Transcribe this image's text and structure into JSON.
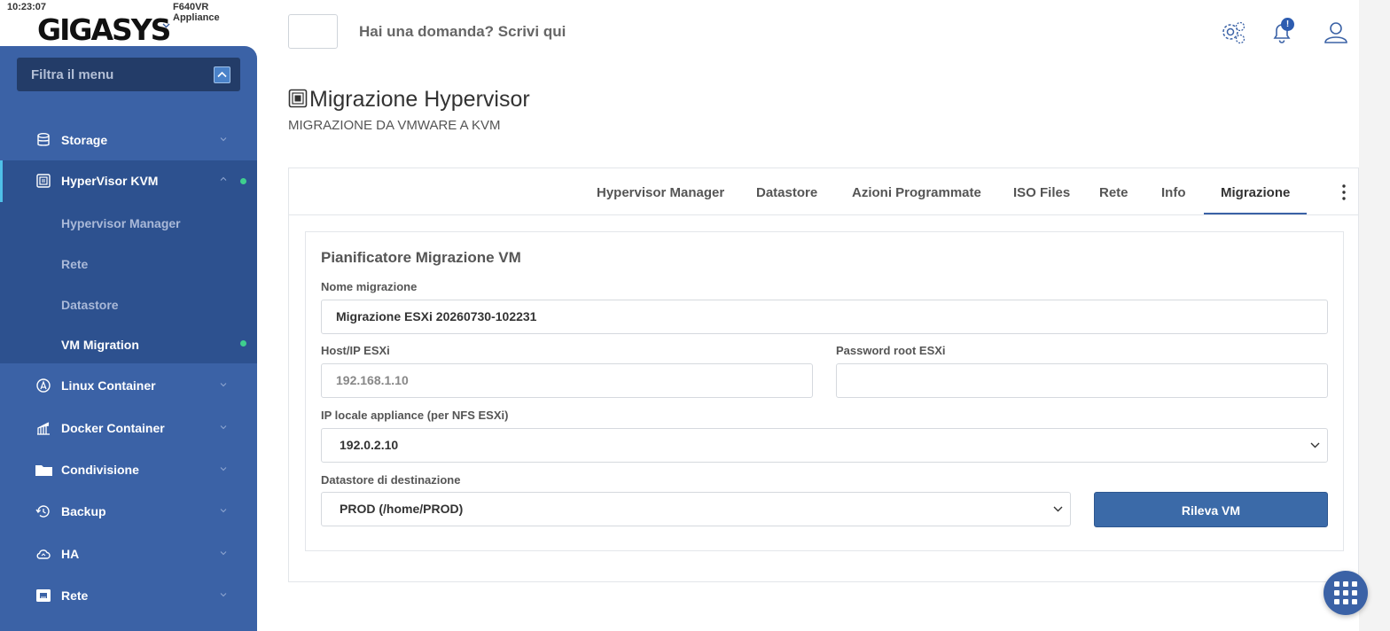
{
  "status": {
    "clock": "10:23:07",
    "appliance": "F640VR Appliance"
  },
  "brand": {
    "name": "GIGASYS"
  },
  "sidebar": {
    "filter_placeholder": "Filtra il menu",
    "items": [
      {
        "label": "Storage",
        "icon": "database-icon"
      },
      {
        "label": "HyperVisor KVM",
        "icon": "hypervisor-icon",
        "active": true
      },
      {
        "label": "Linux Container",
        "icon": "linux-icon"
      },
      {
        "label": "Docker Container",
        "icon": "docker-icon"
      },
      {
        "label": "Condivisione",
        "icon": "folder-icon"
      },
      {
        "label": "Backup",
        "icon": "backup-icon"
      },
      {
        "label": "HA",
        "icon": "cloud-icon"
      },
      {
        "label": "Rete",
        "icon": "network-icon"
      }
    ],
    "submenu": [
      {
        "label": "Hypervisor Manager"
      },
      {
        "label": "Rete"
      },
      {
        "label": "Datastore"
      },
      {
        "label": "VM Migration",
        "current": true
      }
    ]
  },
  "header": {
    "search_prompt": "Hai una domanda? Scrivi qui",
    "notification_badge": "!"
  },
  "page": {
    "title": "Migrazione Hypervisor",
    "subtitle": "MIGRAZIONE DA VMWARE A KVM"
  },
  "tabs": [
    {
      "label": "Hypervisor Manager"
    },
    {
      "label": "Datastore"
    },
    {
      "label": "Azioni Programmate"
    },
    {
      "label": "ISO Files"
    },
    {
      "label": "Rete"
    },
    {
      "label": "Info"
    },
    {
      "label": "Migrazione",
      "selected": true
    }
  ],
  "form": {
    "title": "Pianificatore Migrazione VM",
    "name_label": "Nome migrazione",
    "name_value": "Migrazione ESXi 20260730-102231",
    "host_label": "Host/IP ESXi",
    "host_placeholder": "192.168.1.10",
    "password_label": "Password root ESXi",
    "password_value": "",
    "local_ip_label": "IP locale appliance (per NFS ESXi)",
    "local_ip_value": "192.0.2.10",
    "datastore_label": "Datastore di destinazione",
    "datastore_value": "PROD (/home/PROD)",
    "detect_button": "Rileva VM"
  },
  "colors": {
    "sidebar": "#3b62a6",
    "sidebar_active": "#2d518f",
    "accent": "#3b6aa8",
    "status_dot": "#3fcf8e"
  }
}
